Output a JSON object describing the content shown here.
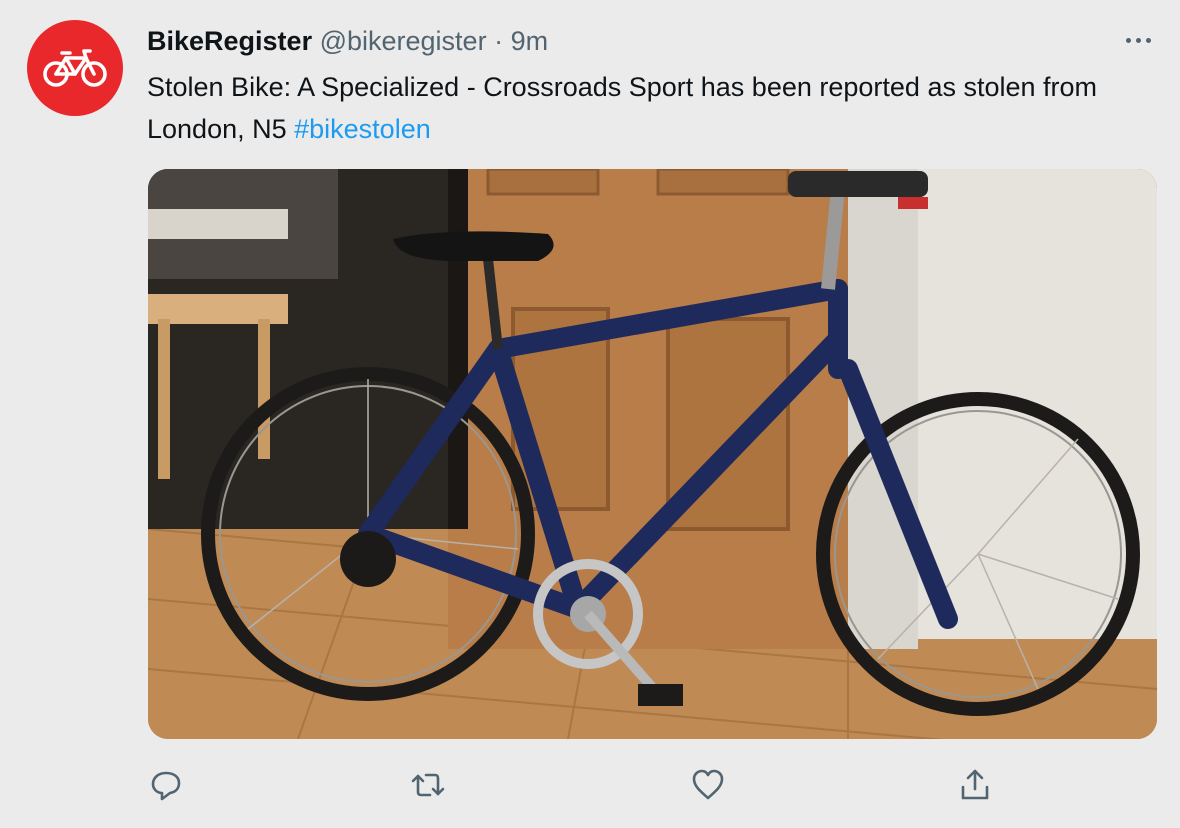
{
  "tweet": {
    "display_name": "BikeRegister",
    "handle": "@bikeregister",
    "separator": "·",
    "time": "9m",
    "text_main": "Stolen Bike: A Specialized - Crossroads Sport has been reported as stolen from London, N5 ",
    "hashtag": "#bikestolen"
  },
  "icons": {
    "avatar": "bicycle-icon",
    "more": "more-icon",
    "reply": "reply-icon",
    "retweet": "retweet-icon",
    "like": "heart-icon",
    "share": "share-icon"
  },
  "colors": {
    "avatar_bg": "#e8282b",
    "hashtag": "#1d9bf0",
    "secondary_text": "#536471",
    "background": "#ebebeb"
  }
}
